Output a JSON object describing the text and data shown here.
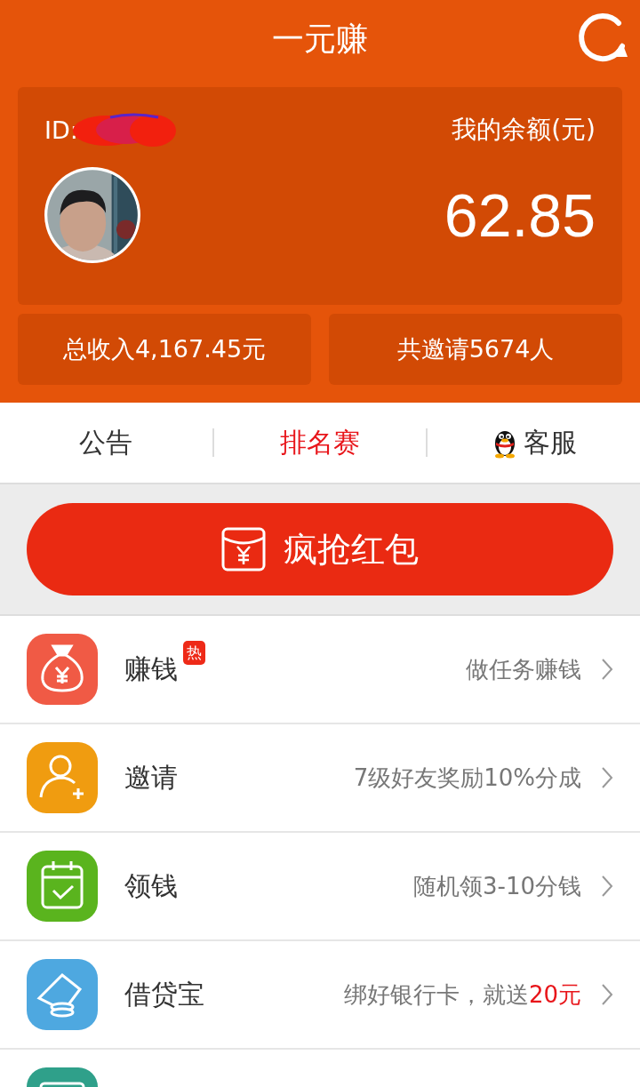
{
  "header": {
    "title": "一元赚"
  },
  "account": {
    "id_label": "ID:",
    "id_redacted": true,
    "balance_label": "我的余额(元)",
    "balance": "62.85"
  },
  "stats": [
    "总收入4,167.45元",
    "共邀请5674人"
  ],
  "tabs": [
    {
      "label": "公告",
      "selected": false,
      "kind": "plain"
    },
    {
      "label": "排名赛",
      "selected": true,
      "kind": "plain"
    },
    {
      "label": "客服",
      "selected": false,
      "kind": "support"
    }
  ],
  "red_packet_button": {
    "label": "疯抢红包"
  },
  "menu": [
    {
      "kind": "money-bag",
      "color": "#f05a45",
      "label": "赚钱",
      "badge": "热",
      "desc": "做任务赚钱"
    },
    {
      "kind": "person-add",
      "color": "#f09c10",
      "label": "邀请",
      "desc": "7级好友奖励10%分成"
    },
    {
      "kind": "calendar-check",
      "color": "#5ab41e",
      "label": "领钱",
      "desc": "随机领3-10分钱"
    },
    {
      "kind": "card-coins",
      "color": "#4ea8e0",
      "label": "借贷宝",
      "desc": "绑好银行卡，就送",
      "desc_highlight": "20元"
    },
    {
      "kind": "card",
      "color": "#2fa08a"
    }
  ]
}
